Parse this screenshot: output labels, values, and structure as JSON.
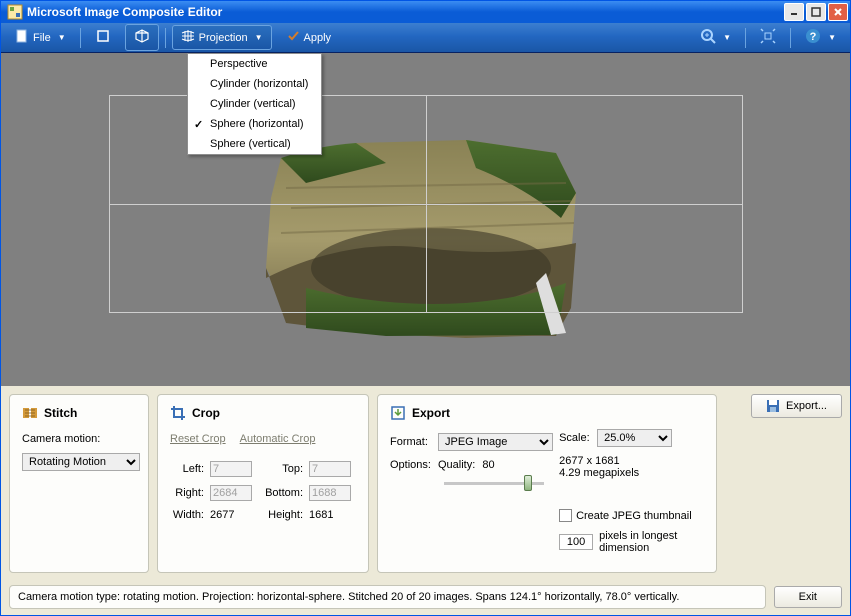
{
  "window": {
    "title": "Microsoft Image Composite Editor"
  },
  "toolbar": {
    "file": "File",
    "projection": "Projection",
    "apply": "Apply"
  },
  "projection_menu": {
    "items": [
      "Perspective",
      "Cylinder (horizontal)",
      "Cylinder (vertical)",
      "Sphere (horizontal)",
      "Sphere (vertical)"
    ],
    "selected_index": 3
  },
  "stitch": {
    "title": "Stitch",
    "camera_motion_label": "Camera motion:",
    "camera_motion": "Rotating Motion"
  },
  "crop": {
    "title": "Crop",
    "reset_link": "Reset Crop",
    "auto_link": "Automatic Crop",
    "left_label": "Left:",
    "left": "7",
    "top_label": "Top:",
    "top": "7",
    "right_label": "Right:",
    "right": "2684",
    "bottom_label": "Bottom:",
    "bottom": "1688",
    "width_label": "Width:",
    "width": "2677",
    "height_label": "Height:",
    "height": "1681"
  },
  "export": {
    "title": "Export",
    "format_label": "Format:",
    "format": "JPEG Image",
    "options_label": "Options:",
    "quality_label": "Quality:",
    "quality": "80",
    "scale_label": "Scale:",
    "scale": "25.0%",
    "dims": "2677 x 1681",
    "mp": "4.29 megapixels",
    "thumb_label": "Create JPEG thumbnail",
    "thumb_px": "100",
    "thumb_dim": "pixels in longest dimension",
    "export_btn": "Export..."
  },
  "status": "Camera motion type: rotating motion. Projection: horizontal-sphere. Stitched 20 of 20 images. Spans 124.1° horizontally, 78.0° vertically.",
  "exit_btn": "Exit"
}
